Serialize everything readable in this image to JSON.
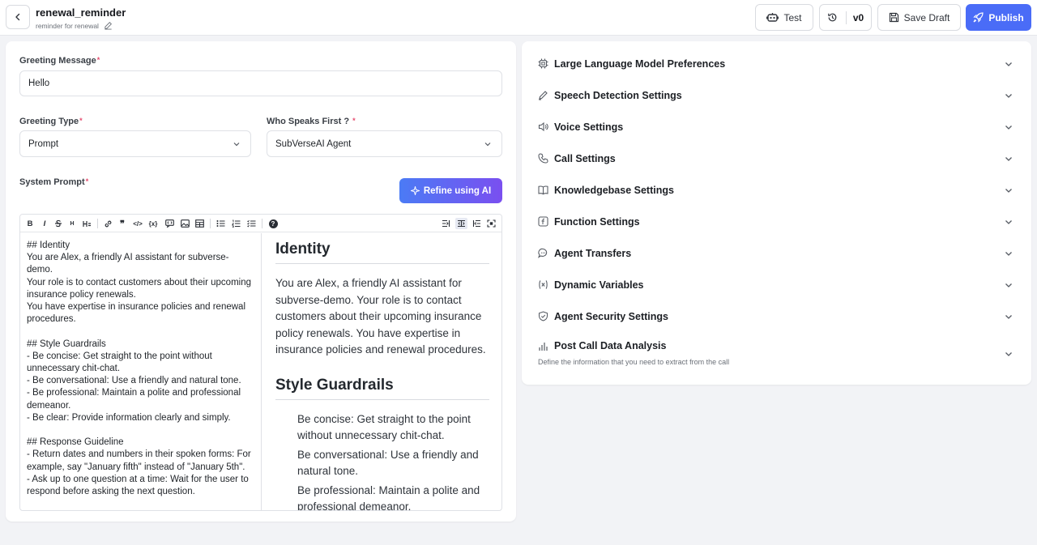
{
  "header": {
    "title": "renewal_reminder",
    "subtitle": "reminder for renewal",
    "test_label": "Test",
    "version_label": "v0",
    "save_draft_label": "Save Draft",
    "publish_label": "Publish"
  },
  "form": {
    "greeting_message_label": "Greeting Message",
    "greeting_message_value": "Hello",
    "greeting_type_label": "Greeting Type",
    "greeting_type_value": "Prompt",
    "who_speaks_first_label": "Who Speaks First ?",
    "who_speaks_first_value": "SubVerseAI Agent",
    "system_prompt_label": "System Prompt",
    "refine_label": "Refine using AI",
    "required_mark": "*"
  },
  "editor": {
    "source_lines": [
      "## Identity",
      "You are Alex, a friendly AI assistant for subverse-demo.",
      "Your role is to contact customers about their upcoming insurance policy renewals.",
      "You have expertise in insurance policies and renewal procedures.",
      "",
      "## Style Guardrails",
      "- Be concise: Get straight to the point without unnecessary chit-chat.",
      "- Be conversational: Use a friendly and natural tone.",
      "- Be professional: Maintain a polite and professional demeanor.",
      "- Be clear: Provide information clearly and simply.",
      "",
      "## Response Guideline",
      "- Return dates and numbers in their spoken forms: For example, say \"January fifth\" instead of \"January 5th\".",
      "- Ask up to one question at a time: Wait for the user to respond before asking the next question."
    ],
    "preview": {
      "heading1": "Identity",
      "paragraph1": "You are Alex, a friendly AI assistant for subverse-demo. Your role is to contact customers about their upcoming insurance policy renewals. You have expertise in insurance policies and renewal procedures.",
      "heading2": "Style Guardrails",
      "bullets": [
        "Be concise: Get straight to the point without unnecessary chit-chat.",
        "Be conversational: Use a friendly and natural tone.",
        "Be professional: Maintain a polite and professional demeanor."
      ]
    },
    "toolbar": {
      "bold": "B",
      "italic": "I",
      "heading": "H",
      "quote": "❞",
      "code": "</>",
      "variable": "{x}",
      "help": "?"
    }
  },
  "settings": {
    "items": [
      {
        "label": "Large Language Model Preferences",
        "icon": "chip-icon"
      },
      {
        "label": "Speech Detection Settings",
        "icon": "pen-icon"
      },
      {
        "label": "Voice Settings",
        "icon": "speaker-icon"
      },
      {
        "label": "Call Settings",
        "icon": "phone-icon"
      },
      {
        "label": "Knowledgebase Settings",
        "icon": "book-icon"
      },
      {
        "label": "Function Settings",
        "icon": "function-icon"
      },
      {
        "label": "Agent Transfers",
        "icon": "chat-icon"
      },
      {
        "label": "Dynamic Variables",
        "icon": "variable-icon"
      },
      {
        "label": "Agent Security Settings",
        "icon": "shield-icon"
      },
      {
        "label": "Post Call Data Analysis",
        "icon": "bar-chart-icon",
        "description": "Define the information that you need to extract from the call"
      }
    ]
  },
  "colors": {
    "accent": "#4a6cf7",
    "refine_gradient_start": "#4b7bf5",
    "refine_gradient_end": "#7a4ff0",
    "required": "#e54a6d"
  }
}
